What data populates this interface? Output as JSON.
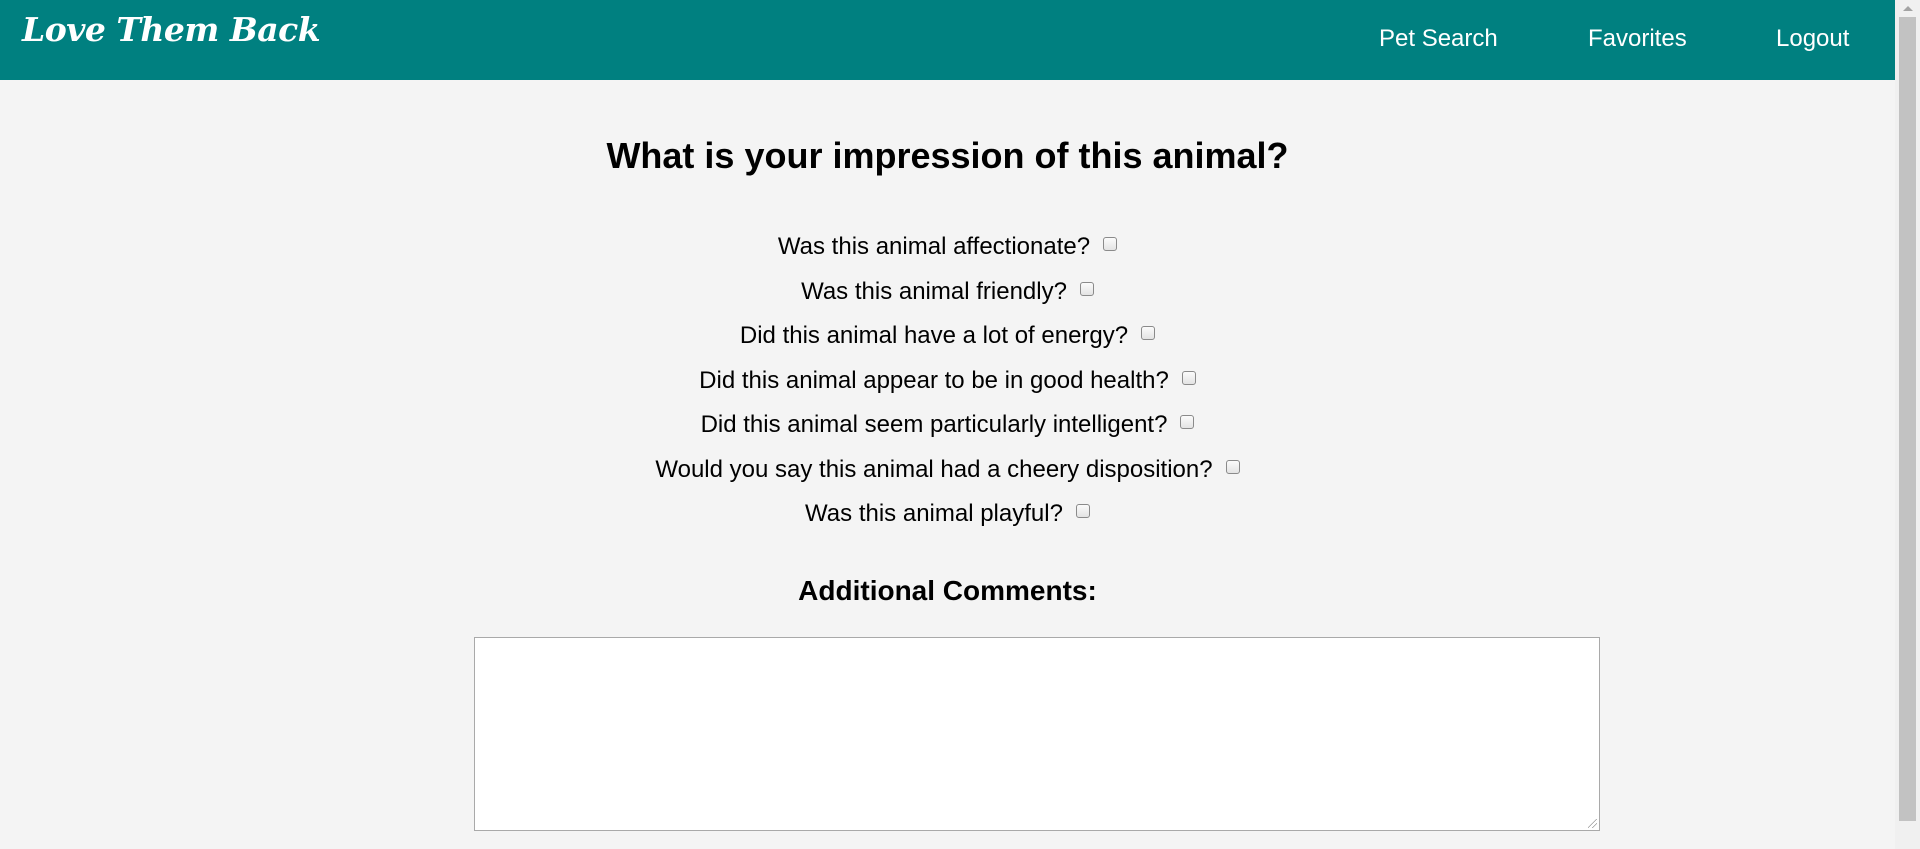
{
  "header": {
    "brand": "Love Them Back",
    "nav": [
      {
        "label": "Pet Search"
      },
      {
        "label": "Favorites"
      },
      {
        "label": "Logout"
      }
    ]
  },
  "main": {
    "title": "What is your impression of this animal?",
    "questions": [
      {
        "label": "Was this animal affectionate?",
        "checked": false
      },
      {
        "label": "Was this animal friendly?",
        "checked": false
      },
      {
        "label": "Did this animal have a lot of energy?",
        "checked": false
      },
      {
        "label": "Did this animal appear to be in good health?",
        "checked": false
      },
      {
        "label": "Did this animal seem particularly intelligent?",
        "checked": false
      },
      {
        "label": "Would you say this animal had a cheery disposition?",
        "checked": false
      },
      {
        "label": "Was this animal playful?",
        "checked": false
      }
    ],
    "comments": {
      "label": "Additional Comments:",
      "value": ""
    }
  },
  "colors": {
    "header_bg": "#008080",
    "page_bg": "#f4f4f4"
  }
}
